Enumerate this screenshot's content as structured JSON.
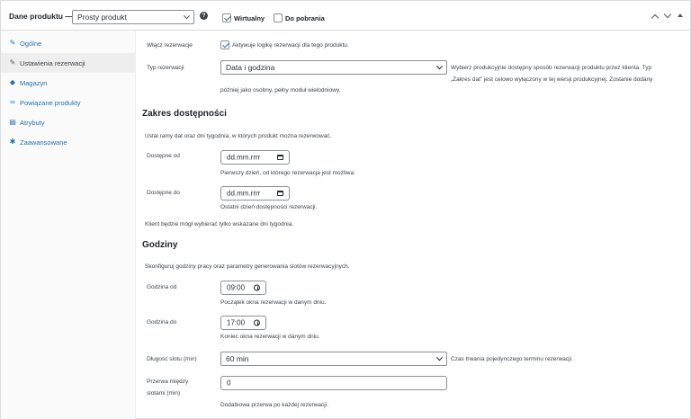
{
  "header": {
    "title": "Dane produktu —",
    "product_type": "Prosty produkt",
    "help": "?",
    "virtual_label": "Wirtualny",
    "virtual_checked": true,
    "download_label": "Do pobrania",
    "download_checked": false
  },
  "sidebar": {
    "items": [
      {
        "label": "Ogólne",
        "icon": "wrench-icon",
        "glyph": "✎"
      },
      {
        "label": "Ustawienia rezerwacji",
        "icon": "wrench-icon",
        "glyph": "✎"
      },
      {
        "label": "Magazyn",
        "icon": "diamond-icon",
        "glyph": "◆"
      },
      {
        "label": "Powiązane produkty",
        "icon": "link-icon",
        "glyph": "∞"
      },
      {
        "label": "Atrybuty",
        "icon": "list-icon",
        "glyph": "▤"
      },
      {
        "label": "Zaawansowane",
        "icon": "gear-icon",
        "glyph": "✱"
      }
    ]
  },
  "main": {
    "enable_label": "Włącz rezerwacje",
    "enable_desc": "Aktywuje logikę rezerwacji dla tego produktu.",
    "type_label": "Typ rezerwacji",
    "type_value": "Data i godzina",
    "type_desc_1": "Wybierz produkcyjnie dostępny sposób rezerwacji produktu przez klienta.  Typ",
    "type_desc_2": "„Zakres dat” jest celowo wyłączony w tej wersji produkcyjnej. Zostanie dodany",
    "type_desc_3": "później jako osobny, pełny moduł wielodniowy.",
    "range_heading": "Zakres dostępności",
    "range_intro": "Ustal ramy dat oraz dni tygodnia, w których produkt można rezerwować.",
    "from_label": "Dostępne od",
    "from_value": "dd.mm.rrrr",
    "from_desc": "Pierwszy dzień, od którego rezerwacja jest możliwa.",
    "to_label": "Dostępne do",
    "to_value": "dd.mm.rrrr",
    "to_desc": "Ostatni dzień dostępności rezerwacji.",
    "days_note": "Klient będzie mógł wybierać tylko wskazane dni tygodnia.",
    "hours_heading": "Godziny",
    "hours_intro": "Skonfiguruj godziny pracy oraz parametry generowania slotów rezerwacyjnych.",
    "start_label": "Godzina od",
    "start_value": "09:00",
    "start_desc": "Początek okna rezerwacji w danym dniu.",
    "end_label": "Godzina do",
    "end_value": "17:00",
    "end_desc": "Koniec okna rezerwacji w danym dniu.",
    "slot_label": "Długość slotu (min)",
    "slot_value": "60 min",
    "slot_desc": "Czas trwania pojedynczego terminu rezerwacji.",
    "break_label_1": "Przerwa między",
    "break_label_2": "slotami (min)",
    "break_value": "0",
    "break_desc": "Dodatkowa przerwa po każdej rezerwacji."
  },
  "colors": {
    "accent": "#2271b1",
    "active_bg": "#eeeeee"
  }
}
